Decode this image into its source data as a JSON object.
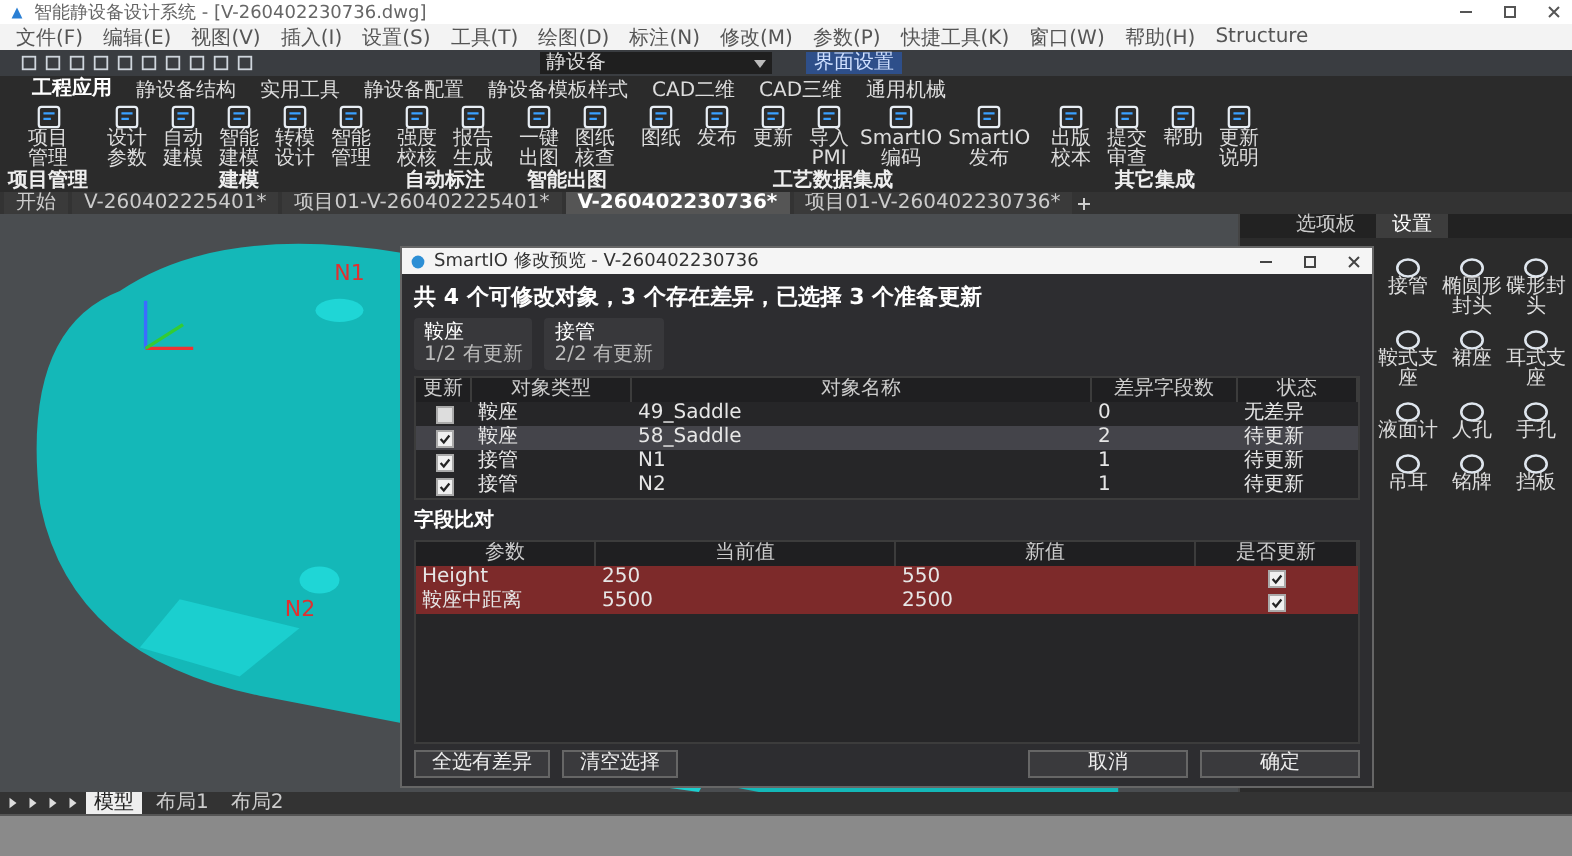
{
  "window": {
    "title": "智能静设备设计系统 - [V-260402230736.dwg]"
  },
  "menu": [
    "文件(F)",
    "编辑(E)",
    "视图(V)",
    "插入(I)",
    "设置(S)",
    "工具(T)",
    "绘图(D)",
    "标注(N)",
    "修改(M)",
    "参数(P)",
    "快捷工具(K)",
    "窗口(W)",
    "帮助(H)",
    "Structure"
  ],
  "toolbar": {
    "combo_value": "静设备",
    "settings_button": "界面设置"
  },
  "ribbon_tabs": [
    {
      "label": "工程应用",
      "selected": true
    },
    {
      "label": "静设备结构",
      "selected": false
    },
    {
      "label": "实用工具",
      "selected": false
    },
    {
      "label": "静设备配置",
      "selected": false
    },
    {
      "label": "静设备模板样式",
      "selected": false
    },
    {
      "label": "CAD二维",
      "selected": false
    },
    {
      "label": "CAD三维",
      "selected": false
    },
    {
      "label": "通用机械",
      "selected": false
    }
  ],
  "ribbon_groups": [
    {
      "label": "项目管理",
      "buttons": [
        "项目管理"
      ]
    },
    {
      "label": "建模",
      "buttons": [
        "设计参数",
        "自动建模",
        "智能建模",
        "转模设计",
        "智能管理"
      ]
    },
    {
      "label": "自动标注",
      "buttons": [
        "强度校核",
        "报告生成"
      ]
    },
    {
      "label": "智能出图",
      "buttons": [
        "一键出图",
        "图纸核查"
      ]
    },
    {
      "label": "工艺数据集成",
      "buttons": [
        "图纸",
        "发布",
        "更新",
        "导入PMI",
        "SmartIO编码",
        "SmartIO发布"
      ]
    },
    {
      "label": "其它集成",
      "buttons": [
        "出版校本",
        "提交审查",
        "帮助",
        "更新说明"
      ]
    }
  ],
  "doc_tabs": [
    {
      "label": "开始",
      "selected": false
    },
    {
      "label": "V-260402225401*",
      "selected": false
    },
    {
      "label": "项目01-V-260402225401*",
      "selected": false
    },
    {
      "label": "V-260402230736*",
      "selected": true
    },
    {
      "label": "项目01-V-260402230736*",
      "selected": false
    }
  ],
  "canvas": {
    "labels": [
      "N1",
      "N2"
    ]
  },
  "side_panel": {
    "tabs": [
      {
        "label": "选项板",
        "selected": false
      },
      {
        "label": "设置",
        "selected": true
      }
    ],
    "items": [
      "接管",
      "椭圆形封头",
      "碟形封头",
      "鞍式支座",
      "裙座",
      "耳式支座",
      "液面计",
      "人孔",
      "手孔",
      "吊耳",
      "铭牌",
      "挡板"
    ]
  },
  "dialog": {
    "title": "SmartIO 修改预览 - V-260402230736",
    "summary": "共 4 个可修改对象，3 个存在差异，已选择 3 个准备更新",
    "cards": [
      {
        "title": "鞍座",
        "detail": "1/2 有更新"
      },
      {
        "title": "接管",
        "detail": "2/2 有更新"
      }
    ],
    "table": {
      "columns": [
        "更新",
        "对象类型",
        "对象名称",
        "差异字段数",
        "状态"
      ],
      "rows": [
        {
          "checked": false,
          "selected": false,
          "type": "鞍座",
          "name": "49_Saddle",
          "diff": "0",
          "status": "无差异"
        },
        {
          "checked": true,
          "selected": true,
          "type": "鞍座",
          "name": "58_Saddle",
          "diff": "2",
          "status": "待更新"
        },
        {
          "checked": true,
          "selected": false,
          "type": "接管",
          "name": "N1",
          "diff": "1",
          "status": "待更新"
        },
        {
          "checked": true,
          "selected": false,
          "type": "接管",
          "name": "N2",
          "diff": "1",
          "status": "待更新"
        }
      ]
    },
    "fields": {
      "title": "字段比对",
      "columns": [
        "参数",
        "当前值",
        "新值",
        "是否更新"
      ],
      "rows": [
        {
          "changed": true,
          "param": "Height",
          "current": "250",
          "new": "550",
          "checked": true
        },
        {
          "changed": true,
          "param": "鞍座中距离",
          "current": "5500",
          "new": "2500",
          "checked": true
        }
      ]
    },
    "left_buttons": [
      "全选有差异",
      "清空选择"
    ],
    "right_buttons": [
      "取消",
      "确定"
    ]
  },
  "layout_tabs": [
    {
      "label": "模型",
      "selected": true
    },
    {
      "label": "布局1",
      "selected": false
    },
    {
      "label": "布局2",
      "selected": false
    }
  ]
}
